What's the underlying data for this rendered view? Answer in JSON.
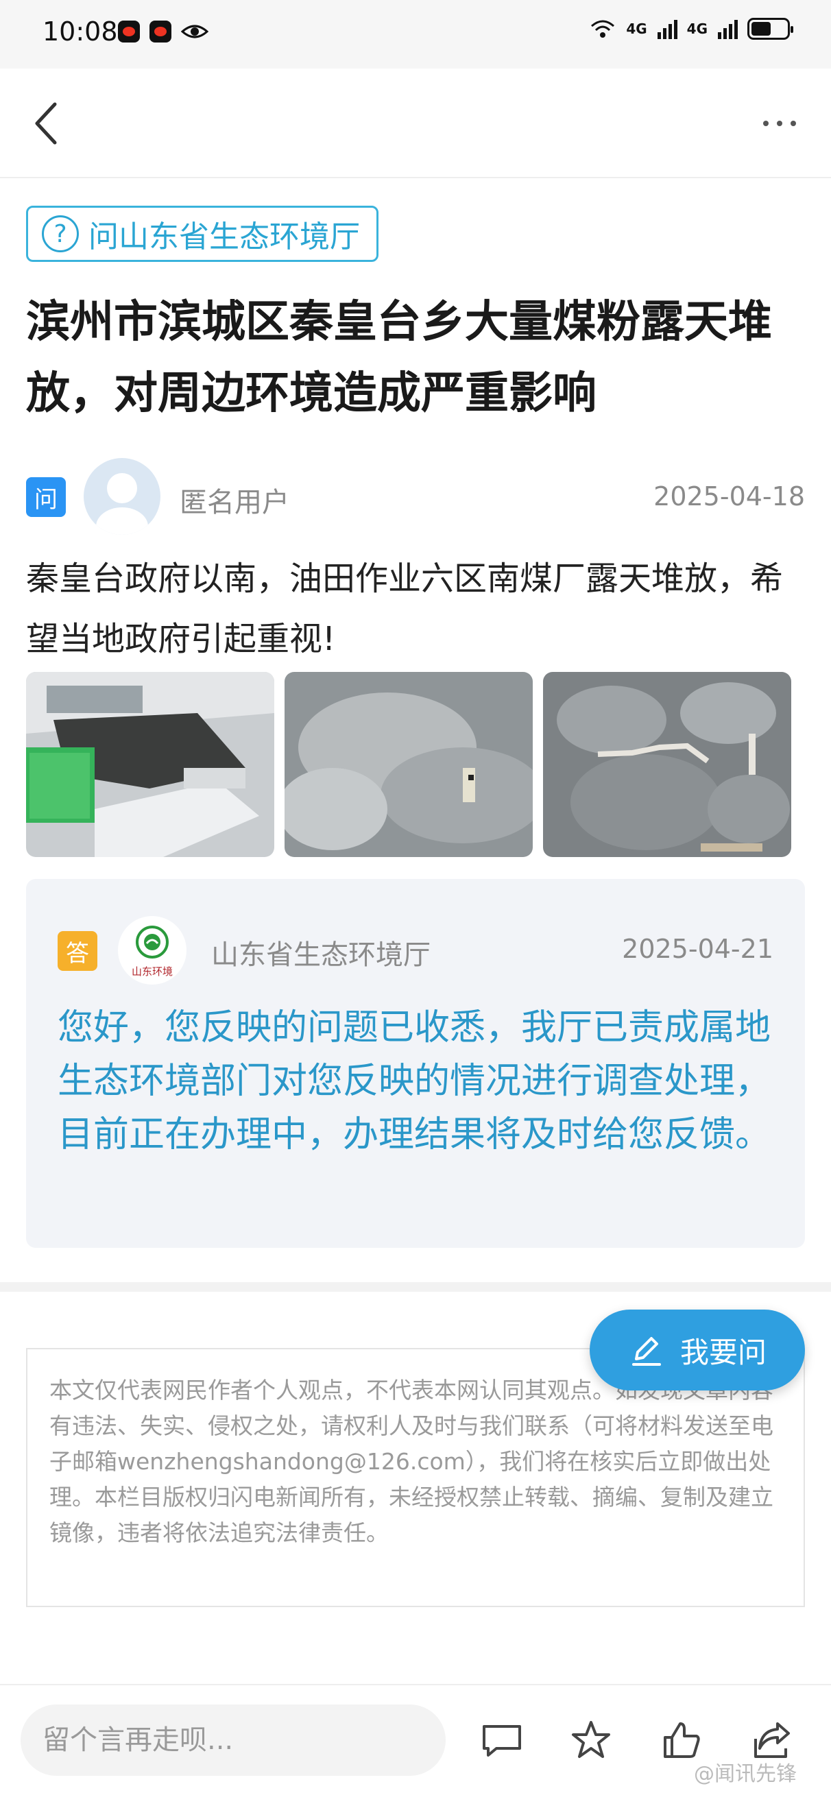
{
  "status_bar": {
    "time": "10:08",
    "net1": "4G",
    "net2": "4G",
    "battery_level": 0.55
  },
  "header": {
    "back_icon": "chevron-left-icon",
    "more_icon": "more-dots-icon"
  },
  "ask_tag": {
    "label": "问山东省生态环境厅",
    "icon": "question-circle-icon"
  },
  "question": {
    "title": "滨州市滨城区秦皇台乡大量煤粉露天堆放，对周边环境造成严重影响",
    "badge": "问",
    "user": "匿名用户",
    "date": "2025-04-18",
    "body": "秦皇台政府以南，油田作业六区南煤厂露天堆放，希望当地政府引起重视!"
  },
  "answer": {
    "badge": "答",
    "org": "山东省生态环境厅",
    "logo_text": "山东环境",
    "date": "2025-04-21",
    "body": "您好，您反映的问题已收悉，我厅已责成属地生态环境部门对您反映的情况进行调查处理，目前正在办理中，办理结果将及时给您反馈。"
  },
  "ask_button": {
    "label": "我要问",
    "icon": "pencil-icon"
  },
  "disclaimer": "本文仅代表网民作者个人观点，不代表本网认同其观点。如发现文章内容有违法、失实、侵权之处，请权利人及时与我们联系（可将材料发送至电子邮箱wenzhengshandong@126.com），我们将在核实后立即做出处理。本栏目版权归闪电新闻所有，未经授权禁止转载、摘编、复制及建立镜像，违者将依法追究法律责任。",
  "bottom_bar": {
    "comment_placeholder": "留个言再走呗...",
    "icons": [
      "comment-icon",
      "star-icon",
      "thumbs-up-icon",
      "share-icon"
    ],
    "watermark": "@闻讯先锋"
  },
  "colors": {
    "accent": "#2f9fe0",
    "answer_text": "#2a97c9",
    "answer_badge": "#f6b02b",
    "question_badge": "#2a94f4"
  }
}
